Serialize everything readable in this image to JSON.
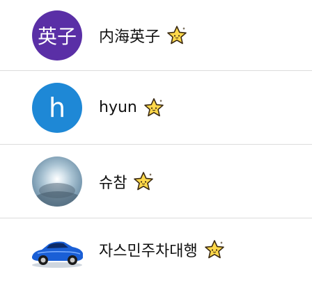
{
  "contacts": [
    {
      "name": "内海英子",
      "avatar_text": "英子",
      "avatar_color": "#5a2fa6"
    },
    {
      "name": "hyun",
      "avatar_text": "h",
      "avatar_color": "#1e88d6"
    },
    {
      "name": "슈참",
      "avatar_image": "sky-photo"
    },
    {
      "name": "자스민주차대행",
      "avatar_image": "blue-sports-car-photo"
    }
  ],
  "badge_icon": "star-sticker-icon"
}
